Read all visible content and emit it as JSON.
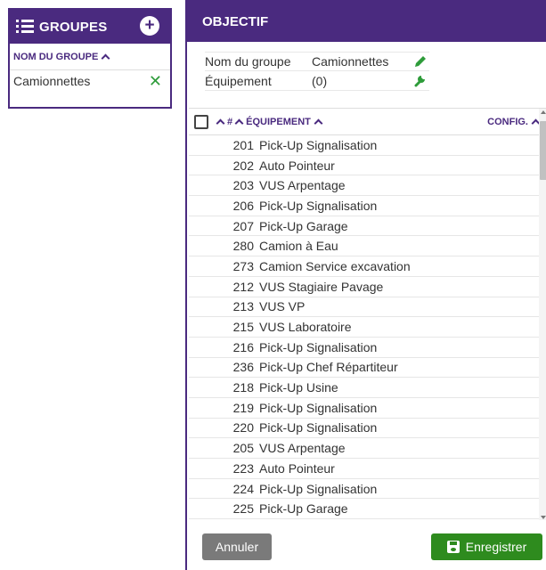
{
  "groups": {
    "title": "GROUPES",
    "column_header": "NOM DU GROUPE",
    "items": [
      {
        "name": "Camionnettes"
      }
    ]
  },
  "objectif": {
    "title": "OBJECTIF",
    "info": {
      "group_name_label": "Nom du groupe",
      "group_name_value": "Camionnettes",
      "equipment_label": "Équipement",
      "equipment_value": "(0)"
    },
    "table": {
      "col_number": "#",
      "col_equipment": "ÉQUIPEMENT",
      "col_config": "CONFIG.",
      "rows": [
        {
          "num": "201",
          "name": "Pick-Up Signalisation"
        },
        {
          "num": "202",
          "name": "Auto Pointeur"
        },
        {
          "num": "203",
          "name": "VUS Arpentage"
        },
        {
          "num": "206",
          "name": "Pick-Up Signalisation"
        },
        {
          "num": "207",
          "name": "Pick-Up Garage"
        },
        {
          "num": "280",
          "name": "Camion à Eau"
        },
        {
          "num": "273",
          "name": "Camion Service excavation"
        },
        {
          "num": "212",
          "name": "VUS Stagiaire Pavage"
        },
        {
          "num": "213",
          "name": "VUS VP"
        },
        {
          "num": "215",
          "name": "VUS Laboratoire"
        },
        {
          "num": "216",
          "name": "Pick-Up Signalisation"
        },
        {
          "num": "236",
          "name": "Pick-Up Chef Répartiteur"
        },
        {
          "num": "218",
          "name": "Pick-Up Usine"
        },
        {
          "num": "219",
          "name": "Pick-Up Signalisation"
        },
        {
          "num": "220",
          "name": "Pick-Up Signalisation"
        },
        {
          "num": "205",
          "name": "VUS Arpentage"
        },
        {
          "num": "223",
          "name": "Auto Pointeur"
        },
        {
          "num": "224",
          "name": "Pick-Up Signalisation"
        },
        {
          "num": "225",
          "name": "Pick-Up Garage"
        }
      ]
    },
    "buttons": {
      "cancel": "Annuler",
      "save": "Enregistrer"
    }
  },
  "colors": {
    "brand_purple": "#4a2a7f",
    "save_green": "#2e8b1e",
    "cancel_gray": "#7a7a7a",
    "remove_green": "#2e9c3a"
  },
  "icons": {
    "groups_header": "list-icon",
    "add": "plus-circle-icon",
    "remove": "close-icon",
    "edit": "pencil-icon",
    "config": "wrench-icon",
    "save": "floppy-disk-icon"
  }
}
